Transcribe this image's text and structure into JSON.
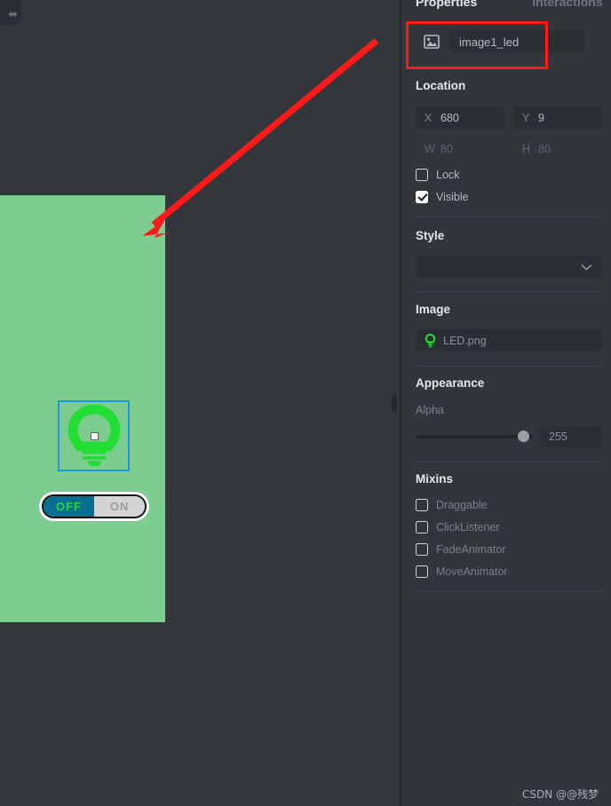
{
  "panel": {
    "tabs": [
      {
        "label": "Properties",
        "active": true
      },
      {
        "label": "Interactions",
        "active": false
      }
    ],
    "element": {
      "icon": "image-icon",
      "name": "image1_led"
    },
    "sections": {
      "location": {
        "title": "Location",
        "fields": [
          {
            "label": "X",
            "value": "680",
            "editable": true
          },
          {
            "label": "Y",
            "value": "9",
            "editable": true
          },
          {
            "label": "W",
            "value": "80",
            "editable": false
          },
          {
            "label": "H",
            "value": "80",
            "editable": false
          }
        ],
        "checkboxes": [
          {
            "label": "Lock",
            "checked": false
          },
          {
            "label": "Visible",
            "checked": true
          }
        ]
      },
      "style": {
        "title": "Style",
        "selected": "",
        "chevron": "chevron-down-icon"
      },
      "image": {
        "title": "Image",
        "filename": "LED.png",
        "thumb": "led-bulb-icon"
      },
      "appearance": {
        "title": "Appearance",
        "alpha_label": "Alpha",
        "alpha_value": "255",
        "alpha_max": "255"
      },
      "mixins": {
        "title": "Mixins",
        "items": [
          {
            "label": "Draggable",
            "checked": false
          },
          {
            "label": "ClickListener",
            "checked": false
          },
          {
            "label": "FadeAnimator",
            "checked": false
          },
          {
            "label": "MoveAnimator",
            "checked": false
          }
        ]
      }
    }
  },
  "canvas": {
    "background_color": "#7dcd90",
    "widgets": {
      "led_image": {
        "name": "image1_led",
        "selected": true,
        "selection_color": "#1f96da",
        "glyph_color": "#22dd33"
      },
      "toggle": {
        "off_label": "OFF",
        "on_label": "ON",
        "state": "OFF",
        "off_bg": "#0a6e92",
        "off_text_color": "#25d83a",
        "on_bg": "#d4d4d4",
        "on_text_color": "#9a9a9a"
      }
    }
  },
  "annotations": {
    "arrow_color": "#ff1a1a",
    "highlight_color": "#ff1a1a",
    "highlight_target": "image1_led"
  },
  "watermark": {
    "text": "CSDN @@残梦"
  }
}
